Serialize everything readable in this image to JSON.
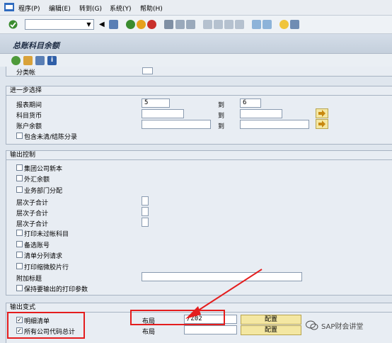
{
  "menu": [
    "程序(P)",
    "编辑(E)",
    "转到(G)",
    "系统(Y)",
    "帮助(H)"
  ],
  "screen_title": "总账科目余额",
  "truncated_field_label": "分类帐",
  "sections": {
    "further": {
      "title": "进一步选择",
      "period_label": "报表期间",
      "period_from": "5",
      "period_to": "6",
      "to_label": "到",
      "currency_label": "科目货币",
      "balance_label": "账户余额",
      "include_clearing_label": "包含未清/结陈分录"
    },
    "output_control": {
      "title": "输出控制",
      "items": [
        "集团公司新本",
        "外汇余额",
        "业务部门分配"
      ],
      "subtotal_label": "层次子合计",
      "print_unposted": "打印未过帐科目",
      "alt_account": "备选账号",
      "list_split": "清单分列请求",
      "print_micro": "打印缩微胶片行",
      "extra_title": "附加标题",
      "keep_params": "保持要输出的打印参数"
    },
    "output_type": {
      "title": "输出变式",
      "detail_list": "明细清单",
      "all_company_total": "所有公司代码总计",
      "layout_label": "布局",
      "layout_value": "/Z02",
      "config_label": "配置"
    }
  },
  "watermark": "SAP财会讲堂",
  "colors": {
    "accent_red": "#e41d1d",
    "button_yellow": "#f4e7a2"
  }
}
